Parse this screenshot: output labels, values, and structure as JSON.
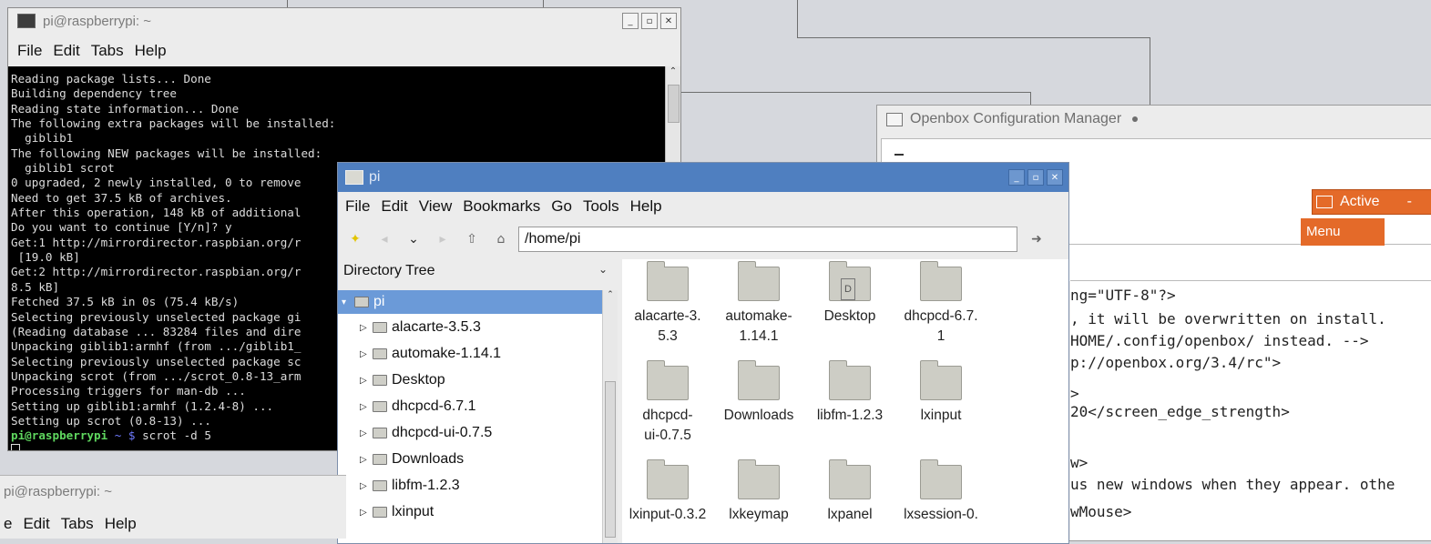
{
  "terminal_top": {
    "title": "pi@raspberrypi: ~",
    "menu": [
      "File",
      "Edit",
      "Tabs",
      "Help"
    ],
    "lines": [
      "Reading package lists... Done",
      "Building dependency tree",
      "Reading state information... Done",
      "The following extra packages will be installed:",
      "  giblib1",
      "The following NEW packages will be installed:",
      "  giblib1 scrot",
      "0 upgraded, 2 newly installed, 0 to remove",
      "Need to get 37.5 kB of archives.",
      "After this operation, 148 kB of additional",
      "Do you want to continue [Y/n]? y",
      "Get:1 http://mirrordirector.raspbian.org/r",
      " [19.0 kB]",
      "Get:2 http://mirrordirector.raspbian.org/r",
      "8.5 kB]",
      "Fetched 37.5 kB in 0s (75.4 kB/s)",
      "Selecting previously unselected package gi",
      "(Reading database ... 83284 files and dire",
      "Unpacking giblib1:armhf (from .../giblib1_",
      "Selecting previously unselected package sc",
      "Unpacking scrot (from .../scrot_0.8-13_arm",
      "Processing triggers for man-db ...",
      "Setting up giblib1:armhf (1.2.4-8) ...",
      "Setting up scrot (0.8-13) ..."
    ],
    "prompt_user": "pi@raspberrypi",
    "prompt_path": " ~ $",
    "command": " scrot -d 5"
  },
  "terminal_bottom": {
    "title": "pi@raspberrypi: ~",
    "menu": [
      "e",
      "Edit",
      "Tabs",
      "Help"
    ]
  },
  "openbox": {
    "title": "Openbox Configuration Manager",
    "active_label": "Active",
    "menu_label": "Menu",
    "xml_lines": [
      "ng=\"UTF-8\"?>",
      ", it will be overwritten on install.",
      "HOME/.config/openbox/ instead. -->",
      "p://openbox.org/3.4/rc\">",
      ">",
      "20</screen_edge_strength>",
      "w>",
      "us new windows when they appear. othe",
      "wMouse>"
    ]
  },
  "file_manager": {
    "title": "pi",
    "menu": [
      "File",
      "Edit",
      "View",
      "Bookmarks",
      "Go",
      "Tools",
      "Help"
    ],
    "location": "/home/pi",
    "sidebar_label": "Directory Tree",
    "tree": [
      "pi",
      "alacarte-3.5.3",
      "automake-1.14.1",
      "Desktop",
      "dhcpcd-6.7.1",
      "dhcpcd-ui-0.7.5",
      "Downloads",
      "libfm-1.2.3",
      "lxinput"
    ],
    "icons": [
      {
        "label": "alacarte-3.\n5.3"
      },
      {
        "label": "automake-\n1.14.1"
      },
      {
        "label": "Desktop"
      },
      {
        "label": "dhcpcd-6.7.\n1"
      },
      {
        "label": "dhcpcd-\nui-0.7.5"
      },
      {
        "label": "Downloads"
      },
      {
        "label": "libfm-1.2.3"
      },
      {
        "label": "lxinput"
      },
      {
        "label": "lxinput-0.3.2"
      },
      {
        "label": "lxkeymap"
      },
      {
        "label": "lxpanel"
      },
      {
        "label": "lxsession-0."
      }
    ]
  }
}
